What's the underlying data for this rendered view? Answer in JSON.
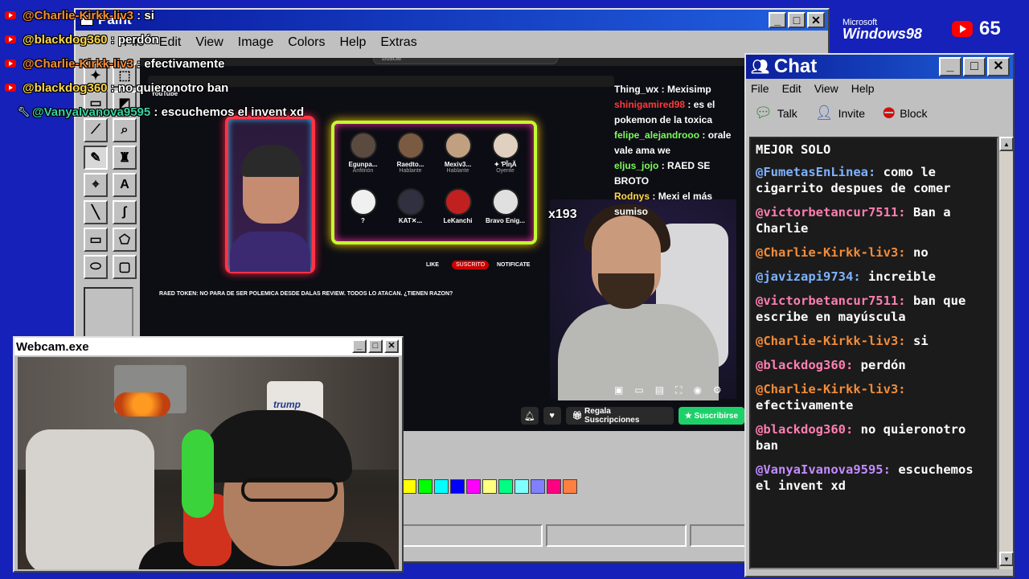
{
  "overlay_chat": [
    {
      "user": "@Charlie-Kirkk-liv3",
      "sep": " : ",
      "text": "si",
      "user_color": "#f28c3a",
      "badge": "youtube"
    },
    {
      "user": "@blackdog360",
      "sep": " : ",
      "text": "perdón",
      "user_color": "#ffd84a",
      "badge": "youtube"
    },
    {
      "user": "@Charlie-Kirkk-liv3",
      "sep": " : ",
      "text": "efectivamente",
      "user_color": "#f28c3a",
      "badge": "youtube"
    },
    {
      "user": "@blackdog360",
      "sep": " : ",
      "text": "no quieronotro ban",
      "user_color": "#ffd84a",
      "badge": "youtube"
    },
    {
      "user": "@VanyaIvanova9595",
      "sep": " : ",
      "text": "escuchemos el invent xd",
      "user_color": "#3ad1a0",
      "badge": "wrench"
    }
  ],
  "paint": {
    "title": "Paint",
    "menu": [
      "File",
      "Edit",
      "View",
      "Image",
      "Colors",
      "Help",
      "Extras"
    ],
    "tools": [
      "select-star-icon",
      "select-rect-icon",
      "eraser-icon",
      "fill-bucket-icon",
      "eyedropper-icon",
      "magnifier-icon",
      "pencil-icon",
      "brush-icon",
      "airbrush-icon",
      "text-icon",
      "line-icon",
      "curve-icon",
      "rectangle-icon",
      "polygon-icon",
      "ellipse-icon",
      "rounded-rect-icon"
    ],
    "palette": [
      "#ffff00",
      "#00ff00",
      "#00ffff",
      "#0000ff",
      "#ff00ff",
      "#ffff80",
      "#00ff80",
      "#80ffff",
      "#8080ff",
      "#ff0080",
      "#ff8040"
    ]
  },
  "stream": {
    "search_placeholder": "Buscar",
    "yt_label": "YouTube",
    "speakers": [
      {
        "name": "Egunpa...",
        "role": "Anfitrión"
      },
      {
        "name": "Raedto...",
        "role": "Hablante"
      },
      {
        "name": "Mexiv3...",
        "role": "Hablante"
      },
      {
        "name": "✦ ƤĨᶇĂ",
        "role": "Oyente"
      },
      {
        "name": "?",
        "role": ""
      },
      {
        "name": "KAT✕...",
        "role": ""
      },
      {
        "name": "LeKanchi",
        "role": ""
      },
      {
        "name": "Bravo Enig...",
        "role": ""
      }
    ],
    "video_title": "RAED TOKEN: NO PARA DE SER POLEMICA DESDE DALAS REVIEW. TODOS LO ATACAN. ¿TIENEN RAZON?",
    "subscribed_label": "SUSCRITO",
    "notify_label": "NOTIFICATE",
    "like_label": "LIKE",
    "multiplier": "x193",
    "gift_label": "Regala Suscripciones",
    "subscribe_label": "Suscribirse",
    "inner_chat": [
      {
        "user": "Thing_wx",
        "text": "Mexisimp",
        "color": "#ffffff"
      },
      {
        "user": "shinigamired98",
        "text": "es el pokemon de la toxica",
        "color": "#ff3a3a"
      },
      {
        "user": "felipe_alejandrooo",
        "text": "orale vale ama we",
        "color": "#7cfc5a"
      },
      {
        "user": "eljus_jojo",
        "text": "RAED SE BROTO",
        "color": "#7cfc5a"
      },
      {
        "user": "Rodnys",
        "text": "Mexi el más sumiso",
        "color": "#ffd84a"
      }
    ]
  },
  "branding": {
    "ms": "Microsoft",
    "windows": "Windows98"
  },
  "viewers": {
    "count": "65"
  },
  "chat_window": {
    "title": "Chat",
    "menu": [
      "File",
      "Edit",
      "View",
      "Help"
    ],
    "tools": [
      {
        "label": "Talk",
        "icon": "talk-icon"
      },
      {
        "label": "Invite",
        "icon": "invite-icon"
      },
      {
        "label": "Block",
        "icon": "block-icon"
      }
    ],
    "partial_top": "MEJOR SOLO",
    "messages": [
      {
        "user": "@FumetasEnLinea:",
        "text": "como le cigarrito despues de comer",
        "color": "#7fb2ff"
      },
      {
        "user": "@victorbetancur7511:",
        "text": "Ban a Charlie",
        "color": "#ff7fb0"
      },
      {
        "user": "@Charlie-Kirkk-liv3:",
        "text": "no",
        "color": "#f28c3a"
      },
      {
        "user": "@javizapi9734:",
        "text": "increible",
        "color": "#7fb2ff"
      },
      {
        "user": "@victorbetancur7511:",
        "text": "ban que escribe en mayúscula",
        "color": "#ff7fb0"
      },
      {
        "user": "@Charlie-Kirkk-liv3:",
        "text": "si",
        "color": "#f28c3a"
      },
      {
        "user": "@blackdog360:",
        "text": "perdón",
        "color": "#ff7fb0"
      },
      {
        "user": "@Charlie-Kirkk-liv3:",
        "text": "efectivamente",
        "color": "#f28c3a"
      },
      {
        "user": "@blackdog360:",
        "text": "no quieronotro ban",
        "color": "#ff7fb0"
      },
      {
        "user": "@VanyaIvanova9595:",
        "text": "escuchemos el invent xd",
        "color": "#c28cff"
      }
    ]
  },
  "webcam": {
    "title": "Webcam.exe",
    "box_label": "trump"
  }
}
